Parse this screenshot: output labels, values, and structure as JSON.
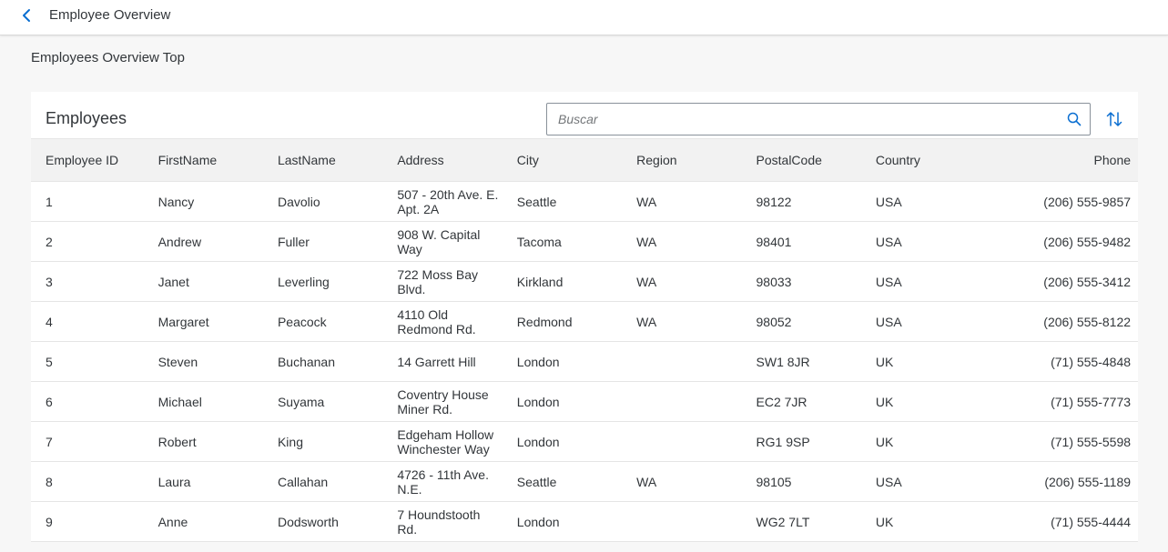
{
  "header": {
    "title": "Employee Overview"
  },
  "page": {
    "subtitle": "Employees Overview Top"
  },
  "table": {
    "title": "Employees",
    "search_placeholder": "Buscar",
    "search_value": "",
    "columns": [
      "Employee ID",
      "FirstName",
      "LastName",
      "Address",
      "City",
      "Region",
      "PostalCode",
      "Country",
      "Phone"
    ],
    "rows": [
      {
        "id": "1",
        "first": "Nancy",
        "last": "Davolio",
        "address": "507 - 20th Ave. E. Apt. 2A",
        "city": "Seattle",
        "region": "WA",
        "postal": "98122",
        "country": "USA",
        "phone": "(206) 555-9857"
      },
      {
        "id": "2",
        "first": "Andrew",
        "last": "Fuller",
        "address": "908 W. Capital Way",
        "city": "Tacoma",
        "region": "WA",
        "postal": "98401",
        "country": "USA",
        "phone": "(206) 555-9482"
      },
      {
        "id": "3",
        "first": "Janet",
        "last": "Leverling",
        "address": "722 Moss Bay Blvd.",
        "city": "Kirkland",
        "region": "WA",
        "postal": "98033",
        "country": "USA",
        "phone": "(206) 555-3412"
      },
      {
        "id": "4",
        "first": "Margaret",
        "last": "Peacock",
        "address": "4110 Old Redmond Rd.",
        "city": "Redmond",
        "region": "WA",
        "postal": "98052",
        "country": "USA",
        "phone": "(206) 555-8122"
      },
      {
        "id": "5",
        "first": "Steven",
        "last": "Buchanan",
        "address": "14 Garrett Hill",
        "city": "London",
        "region": "",
        "postal": "SW1 8JR",
        "country": "UK",
        "phone": "(71) 555-4848"
      },
      {
        "id": "6",
        "first": "Michael",
        "last": "Suyama",
        "address": "Coventry House Miner Rd.",
        "city": "London",
        "region": "",
        "postal": "EC2 7JR",
        "country": "UK",
        "phone": "(71) 555-7773"
      },
      {
        "id": "7",
        "first": "Robert",
        "last": "King",
        "address": "Edgeham Hollow Winchester Way",
        "city": "London",
        "region": "",
        "postal": "RG1 9SP",
        "country": "UK",
        "phone": "(71) 555-5598"
      },
      {
        "id": "8",
        "first": "Laura",
        "last": "Callahan",
        "address": "4726 - 11th Ave. N.E.",
        "city": "Seattle",
        "region": "WA",
        "postal": "98105",
        "country": "USA",
        "phone": "(206) 555-1189"
      },
      {
        "id": "9",
        "first": "Anne",
        "last": "Dodsworth",
        "address": "7 Houndstooth Rd.",
        "city": "London",
        "region": "",
        "postal": "WG2 7LT",
        "country": "UK",
        "phone": "(71) 555-4444"
      }
    ]
  },
  "icons": {
    "back": "chevron-left-icon",
    "search": "search-icon",
    "sort": "sort-icon"
  },
  "colors": {
    "accent": "#0a6ed1",
    "header_bg": "#ffffff",
    "page_bg": "#f7f7f7",
    "table_header_bg": "#f2f2f2",
    "text": "#32363a"
  }
}
